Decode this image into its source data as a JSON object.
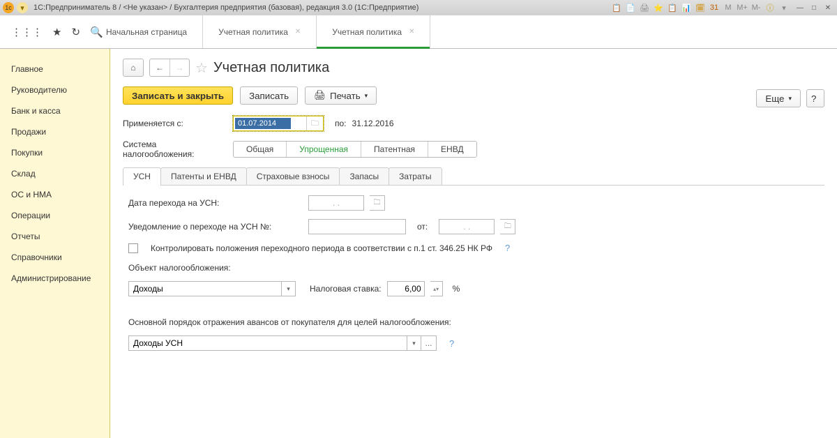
{
  "titlebar": {
    "text": "1С:Предприниматель 8 / <Не указан> / Бухгалтерия предприятия (базовая), редакция 3.0  (1С:Предприятие)",
    "right_icons": [
      "📋",
      "📄",
      "🖨",
      "⭐",
      "📋",
      "📊",
      "🗓",
      "31",
      "M",
      "M+",
      "M-",
      "ⓘ"
    ]
  },
  "tabs": [
    {
      "label": "Начальная страница",
      "closable": false,
      "active": false
    },
    {
      "label": "Учетная политика",
      "closable": true,
      "active": false
    },
    {
      "label": "Учетная политика",
      "closable": true,
      "active": true
    }
  ],
  "sidebar": [
    "Главное",
    "Руководителю",
    "Банк и касса",
    "Продажи",
    "Покупки",
    "Склад",
    "ОС и НМА",
    "Операции",
    "Отчеты",
    "Справочники",
    "Администрирование"
  ],
  "page": {
    "title": "Учетная политика",
    "btn_save_close": "Записать и закрыть",
    "btn_save": "Записать",
    "btn_print": "Печать",
    "btn_more": "Еще",
    "applies_from_label": "Применяется с:",
    "applies_from": "01.07.2014",
    "to_label": "по:",
    "to_date": "31.12.2016",
    "tax_system_label": "Система налогообложения:",
    "tax_system_options": [
      "Общая",
      "Упрощенная",
      "Патентная",
      "ЕНВД"
    ],
    "sub_tabs": [
      "УСН",
      "Патенты и ЕНВД",
      "Страховые взносы",
      "Запасы",
      "Затраты"
    ],
    "usn": {
      "transition_date_label": "Дата перехода на УСН:",
      "transition_date": ". .",
      "notice_label": "Уведомление о переходе на УСН №:",
      "notice_no": "",
      "ot_label": "от:",
      "notice_date": ". .",
      "checkbox_label": "Контролировать положения переходного периода в соответствии с п.1 ст. 346.25 НК РФ",
      "object_label": "Объект налогообложения:",
      "object_value": "Доходы",
      "rate_label": "Налоговая ставка:",
      "rate_value": "6,00",
      "percent": "%",
      "advance_label": "Основной порядок отражения авансов от покупателя для целей налогообложения:",
      "advance_value": "Доходы УСН"
    }
  }
}
